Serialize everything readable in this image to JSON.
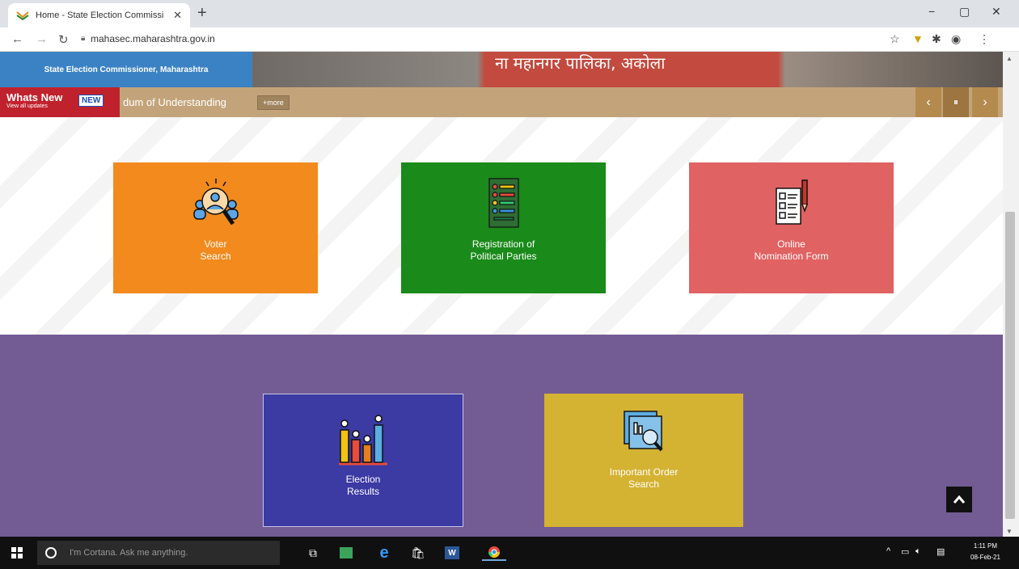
{
  "browser": {
    "tab_title": "Home - State Election Commissi",
    "tab_close": "✕",
    "new_tab": "+",
    "url": "mahasec.maharashtra.gov.in",
    "window_controls": {
      "minimize": "−",
      "maximize": "▢",
      "close": "✕"
    }
  },
  "header": {
    "org_name": "State Election Commissioner, Maharashtra",
    "banner_text": "ना महानगर पालिका, अकोला"
  },
  "ticker": {
    "title": "Whats New",
    "subtitle": "View all updates",
    "badge": "NEW",
    "item_text": "dum of Understanding",
    "more_label": "+more",
    "prev": "‹",
    "pause": "⏸",
    "next": "›"
  },
  "cards": [
    {
      "label": "Voter\nSearch",
      "color": "#f28a1d"
    },
    {
      "label": "Registration of\nPolitical Parties",
      "color": "#1a8a1a"
    },
    {
      "label": "Online\nNomination Form",
      "color": "#e06262"
    },
    {
      "label": "Election\nResults",
      "color": "#3c3aa3"
    },
    {
      "label": "Important Order\nSearch",
      "color": "#d4b232"
    }
  ],
  "taskbar": {
    "cortana_placeholder": "I'm Cortana. Ask me anything.",
    "time": "1:11 PM",
    "date": "08-Feb-21"
  }
}
